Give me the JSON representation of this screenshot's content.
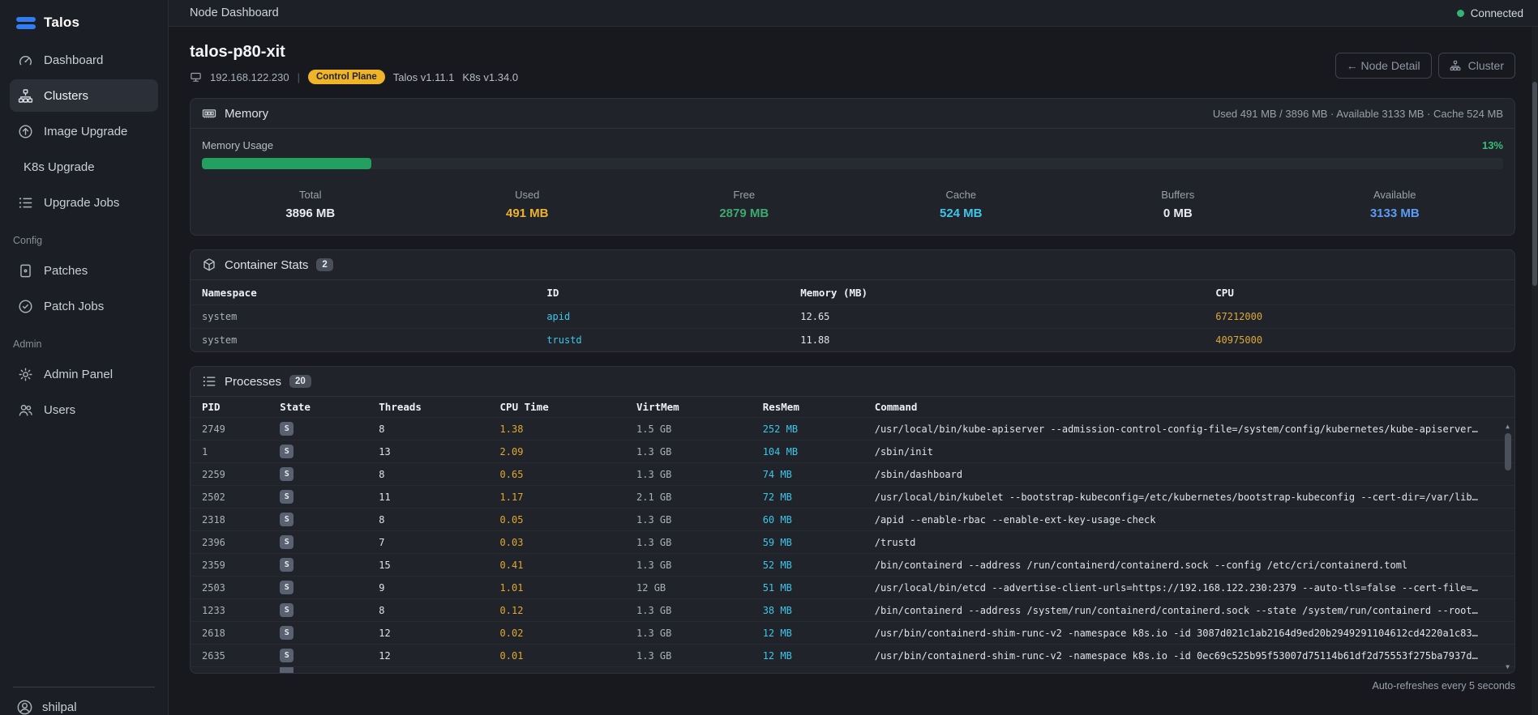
{
  "sidebar": {
    "logo_label": "Talos",
    "nav": [
      {
        "label": "Dashboard",
        "icon": "dashboard-icon",
        "active": false
      },
      {
        "label": "Clusters",
        "icon": "clusters-icon",
        "active": true
      },
      {
        "label": "Image Upgrade",
        "icon": "image-upgrade-icon",
        "active": false
      },
      {
        "label": "K8s Upgrade",
        "icon": "",
        "active": false
      },
      {
        "label": "Upgrade Jobs",
        "icon": "upgrade-jobs-icon",
        "active": false
      }
    ],
    "config_section_label": "Config",
    "config_nav": [
      {
        "label": "Patches",
        "icon": "patches-icon"
      },
      {
        "label": "Patch Jobs",
        "icon": "patch-jobs-icon"
      }
    ],
    "admin_section_label": "Admin",
    "admin_nav": [
      {
        "label": "Admin Panel",
        "icon": "admin-panel-icon"
      },
      {
        "label": "Users",
        "icon": "users-icon"
      }
    ],
    "user_label": "shilpal"
  },
  "topbar": {
    "title": "Node Dashboard",
    "status_label": "Connected",
    "status_color": "#35b374"
  },
  "node": {
    "name": "talos-p80-xit",
    "ip": "192.168.122.230",
    "separator": "|",
    "role_badge": "Control Plane",
    "talos_version": "Talos v1.11.1",
    "k8s_version": "K8s v1.34.0",
    "node_detail_button": "← Node Detail",
    "cluster_button": "Cluster"
  },
  "memory": {
    "title": "Memory",
    "summary": "Used 491 MB / 3896 MB  ·  Available 3133 MB  ·  Cache 524 MB",
    "usage_label": "Memory Usage",
    "usage_percent": "13%",
    "usage_bar_width": "13%",
    "bar_color": "#23a05f",
    "stats": [
      {
        "label": "Total",
        "value": "3896 MB",
        "color": "#e8ebf0"
      },
      {
        "label": "Used",
        "value": "491 MB",
        "color": "#eeb22f"
      },
      {
        "label": "Free",
        "value": "2879 MB",
        "color": "#3da970"
      },
      {
        "label": "Cache",
        "value": "524 MB",
        "color": "#3fc6e8"
      },
      {
        "label": "Buffers",
        "value": "0 MB",
        "color": "#e8ebf0"
      },
      {
        "label": "Available",
        "value": "3133 MB",
        "color": "#5b9cf5"
      }
    ]
  },
  "containers": {
    "title": "Container Stats",
    "count": "2",
    "columns": [
      "Namespace",
      "ID",
      "Memory (MB)",
      "CPU"
    ],
    "rows": [
      {
        "namespace": "system",
        "id": "apid",
        "memory": "12.65",
        "cpu": "67212000"
      },
      {
        "namespace": "system",
        "id": "trustd",
        "memory": "11.88",
        "cpu": "40975000"
      }
    ]
  },
  "processes": {
    "title": "Processes",
    "count": "20",
    "columns": [
      "PID",
      "State",
      "Threads",
      "CPU Time",
      "VirtMem",
      "ResMem",
      "Command"
    ],
    "rows": [
      {
        "pid": "2749",
        "state": "S",
        "threads": "8",
        "cpu_time": "1.38",
        "virt_mem": "1.5 GB",
        "res_mem": "252 MB",
        "command": "/usr/local/bin/kube-apiserver --admission-control-config-file=/system/config/kubernetes/kube-apiserver…"
      },
      {
        "pid": "1",
        "state": "S",
        "threads": "13",
        "cpu_time": "2.09",
        "virt_mem": "1.3 GB",
        "res_mem": "104 MB",
        "command": "/sbin/init"
      },
      {
        "pid": "2259",
        "state": "S",
        "threads": "8",
        "cpu_time": "0.65",
        "virt_mem": "1.3 GB",
        "res_mem": "74 MB",
        "command": "/sbin/dashboard"
      },
      {
        "pid": "2502",
        "state": "S",
        "threads": "11",
        "cpu_time": "1.17",
        "virt_mem": "2.1 GB",
        "res_mem": "72 MB",
        "command": "/usr/local/bin/kubelet --bootstrap-kubeconfig=/etc/kubernetes/bootstrap-kubeconfig --cert-dir=/var/lib…"
      },
      {
        "pid": "2318",
        "state": "S",
        "threads": "8",
        "cpu_time": "0.05",
        "virt_mem": "1.3 GB",
        "res_mem": "60 MB",
        "command": "/apid --enable-rbac --enable-ext-key-usage-check"
      },
      {
        "pid": "2396",
        "state": "S",
        "threads": "7",
        "cpu_time": "0.03",
        "virt_mem": "1.3 GB",
        "res_mem": "59 MB",
        "command": "/trustd"
      },
      {
        "pid": "2359",
        "state": "S",
        "threads": "15",
        "cpu_time": "0.41",
        "virt_mem": "1.3 GB",
        "res_mem": "52 MB",
        "command": "/bin/containerd --address /run/containerd/containerd.sock --config /etc/cri/containerd.toml"
      },
      {
        "pid": "2503",
        "state": "S",
        "threads": "9",
        "cpu_time": "1.01",
        "virt_mem": "12 GB",
        "res_mem": "51 MB",
        "command": "/usr/local/bin/etcd --advertise-client-urls=https://192.168.122.230:2379 --auto-tls=false --cert-file=…"
      },
      {
        "pid": "1233",
        "state": "S",
        "threads": "8",
        "cpu_time": "0.12",
        "virt_mem": "1.3 GB",
        "res_mem": "38 MB",
        "command": "/bin/containerd --address /system/run/containerd/containerd.sock --state /system/run/containerd --root…"
      },
      {
        "pid": "2618",
        "state": "S",
        "threads": "12",
        "cpu_time": "0.02",
        "virt_mem": "1.3 GB",
        "res_mem": "12 MB",
        "command": "/usr/bin/containerd-shim-runc-v2 -namespace k8s.io -id 3087d021c1ab2164d9ed20b2949291104612cd4220a1c83…"
      },
      {
        "pid": "2635",
        "state": "S",
        "threads": "12",
        "cpu_time": "0.01",
        "virt_mem": "1.3 GB",
        "res_mem": "12 MB",
        "command": "/usr/bin/containerd-shim-runc-v2 -namespace k8s.io -id 0ec69c525b95f53007d75114b61df2d75553f275ba7937d…"
      }
    ]
  },
  "footer": {
    "refresh_note": "Auto-refreshes every 5 seconds"
  }
}
